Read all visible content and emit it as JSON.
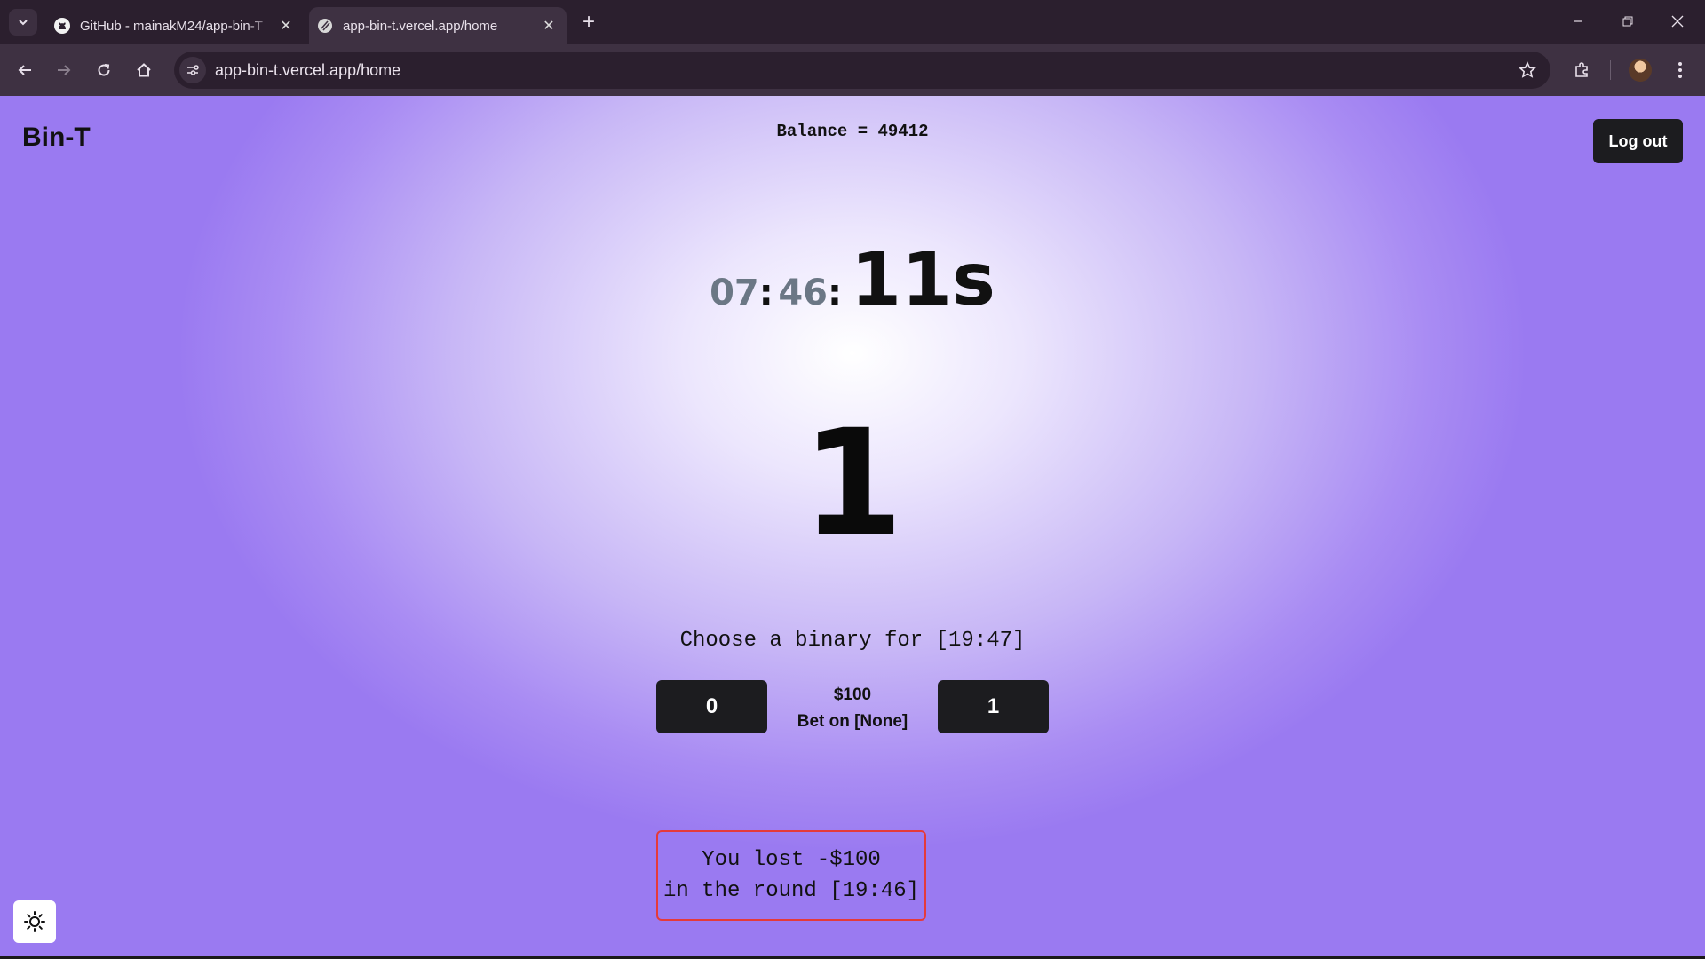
{
  "browser": {
    "tabs": [
      {
        "title": "GitHub - mainakM24/app-bin-T",
        "icon": "github-icon",
        "active": false
      },
      {
        "title": "app-bin-t.vercel.app/home",
        "icon": "site-favicon-icon",
        "active": true
      }
    ],
    "url": "app-bin-t.vercel.app/home"
  },
  "header": {
    "brand": "Bin-T",
    "balance": "Balance = 49412",
    "logout_label": "Log out"
  },
  "timer": {
    "hours": "07",
    "minutes": "46",
    "sep1": ":",
    "sep2": ":",
    "seconds": "11s"
  },
  "current_bit": "1",
  "betting": {
    "prompt": "Choose a binary for [19:47]",
    "zero_label": "0",
    "one_label": "1",
    "amount": "$100",
    "bet_on": "Bet on [None]"
  },
  "result": {
    "line1": "You lost -$100",
    "line2": "in the round [19:46]",
    "border_color": "#e53a3a"
  },
  "colors": {
    "accent": "#9a7af1",
    "button_bg": "#1c1c1f",
    "timer_muted": "#6b7785"
  }
}
